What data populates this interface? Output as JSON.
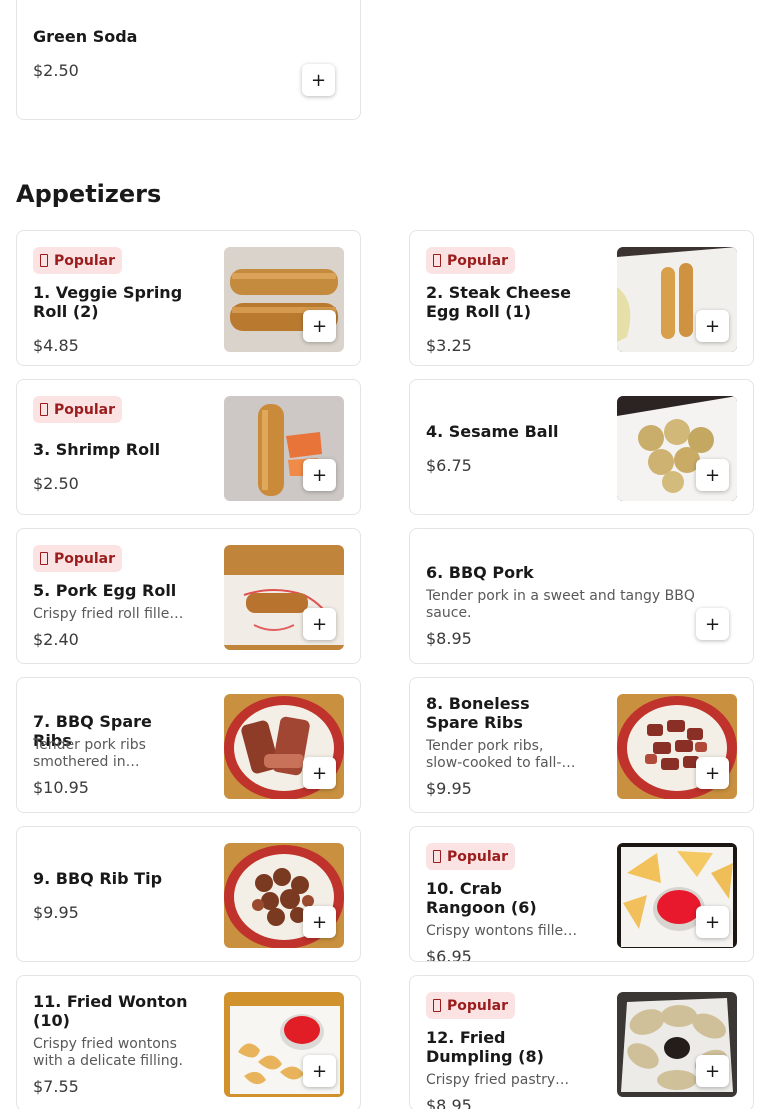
{
  "top_item": {
    "name": "Green Soda",
    "price": "$2.50"
  },
  "section": {
    "title": "Appetizers"
  },
  "badge_label": "Popular",
  "add_symbol": "+",
  "items": [
    {
      "name": "1. Veggie Spring Roll (2)",
      "price": "$4.85",
      "popular": true,
      "description": "",
      "image": "spring-roll-photo"
    },
    {
      "name": "2. Steak Cheese Egg Roll (1)",
      "price": "$3.25",
      "popular": true,
      "description": "",
      "image": "egg-roll-photo"
    },
    {
      "name": "3. Shrimp Roll",
      "price": "$2.50",
      "popular": true,
      "description": "",
      "image": "shrimp-roll-photo"
    },
    {
      "name": "4. Sesame Ball",
      "price": "$6.75",
      "popular": false,
      "description": "",
      "image": "sesame-ball-photo"
    },
    {
      "name": "5. Pork Egg Roll",
      "price": "$2.40",
      "popular": true,
      "description": "Crispy fried roll fille…",
      "image": "pork-egg-roll-photo"
    },
    {
      "name": "6. BBQ Pork",
      "price": "$8.95",
      "popular": false,
      "description": "Tender pork in a sweet and tangy BBQ sauce.",
      "image": ""
    },
    {
      "name": "7. BBQ Spare Ribs",
      "price": "$10.95",
      "popular": false,
      "description": "Tender pork ribs smothered in…",
      "image": "spare-ribs-photo"
    },
    {
      "name": "8. Boneless Spare Ribs",
      "price": "$9.95",
      "popular": false,
      "description": "Tender pork ribs, slow-cooked to fall-apart…",
      "image": "boneless-ribs-photo"
    },
    {
      "name": "9. BBQ Rib Tip",
      "price": "$9.95",
      "popular": false,
      "description": "",
      "image": "rib-tip-photo"
    },
    {
      "name": "10. Crab Rangoon (6)",
      "price": "$6.95",
      "popular": true,
      "description": "Crispy wontons fille…",
      "image": "crab-rangoon-photo"
    },
    {
      "name": "11. Fried Wonton (10)",
      "price": "$7.55",
      "popular": false,
      "description": "Crispy fried wontons with a delicate filling.",
      "image": "fried-wonton-photo"
    },
    {
      "name": "12. Fried Dumpling (8)",
      "price": "$8.95",
      "popular": true,
      "description": "Crispy fried pastry…",
      "image": "fried-dumpling-photo"
    }
  ]
}
